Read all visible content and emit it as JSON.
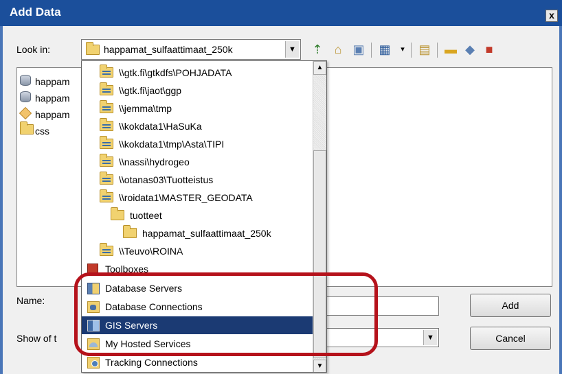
{
  "window": {
    "title": "Add Data",
    "close_label": "x"
  },
  "lookin": {
    "label": "Look in:",
    "value": "happamat_sulfaattimaat_250k"
  },
  "toolbar": {
    "icons": [
      "up-one-level-icon",
      "home-icon",
      "catalog-tree-icon",
      "view-menu-icon",
      "connect-folder-icon",
      "new-folder-icon",
      "new-shapefile-icon",
      "toolbox-icon"
    ]
  },
  "file_list": [
    {
      "label": "happam",
      "icon": "database-icon"
    },
    {
      "label": "happam",
      "icon": "database-icon"
    },
    {
      "label": "happam",
      "icon": "geodatabase-icon"
    },
    {
      "label": "css",
      "icon": "folder-icon"
    }
  ],
  "dropdown": {
    "items": [
      {
        "label": "\\\\gtk.fi\\gtkdfs\\POHJADATA",
        "icon": "network-folder-icon",
        "indent": 1
      },
      {
        "label": "\\\\gtk.fi\\jaot\\ggp",
        "icon": "network-folder-icon",
        "indent": 1
      },
      {
        "label": "\\\\jemma\\tmp",
        "icon": "network-folder-icon",
        "indent": 1
      },
      {
        "label": "\\\\kokdata1\\HaSuKa",
        "icon": "network-folder-icon",
        "indent": 1
      },
      {
        "label": "\\\\kokdata1\\tmp\\Asta\\TIPI",
        "icon": "network-folder-icon",
        "indent": 1
      },
      {
        "label": "\\\\nassi\\hydrogeo",
        "icon": "network-folder-icon",
        "indent": 1
      },
      {
        "label": "\\\\otanas03\\Tuotteistus",
        "icon": "network-folder-icon",
        "indent": 1
      },
      {
        "label": "\\\\roidata1\\MASTER_GEODATA",
        "icon": "network-folder-icon",
        "indent": 1
      },
      {
        "label": "tuotteet",
        "icon": "folder-icon",
        "indent": 2
      },
      {
        "label": "happamat_sulfaattimaat_250k",
        "icon": "folder-icon",
        "indent": 3
      },
      {
        "label": "\\\\Teuvo\\ROINA",
        "icon": "network-folder-icon",
        "indent": 1
      },
      {
        "label": "Toolboxes",
        "icon": "toolbox-icon",
        "indent": 0
      },
      {
        "label": "Database Servers",
        "icon": "database-server-icon",
        "indent": 0
      },
      {
        "label": "Database Connections",
        "icon": "database-connection-icon",
        "indent": 0
      },
      {
        "label": "GIS Servers",
        "icon": "gis-server-icon",
        "indent": 0,
        "selected": true
      },
      {
        "label": "My Hosted Services",
        "icon": "hosted-services-icon",
        "indent": 0
      },
      {
        "label": "Tracking Connections",
        "icon": "tracking-connection-icon",
        "indent": 0
      }
    ]
  },
  "form": {
    "name_label": "Name:",
    "name_value": "",
    "show_of_type_label": "Show of t",
    "show_of_type_value": ""
  },
  "buttons": {
    "add": "Add",
    "cancel": "Cancel"
  },
  "colors": {
    "titlebar": "#1b4f9b",
    "selected_row": "#1b3a73",
    "highlight_outline": "#b5121b"
  }
}
